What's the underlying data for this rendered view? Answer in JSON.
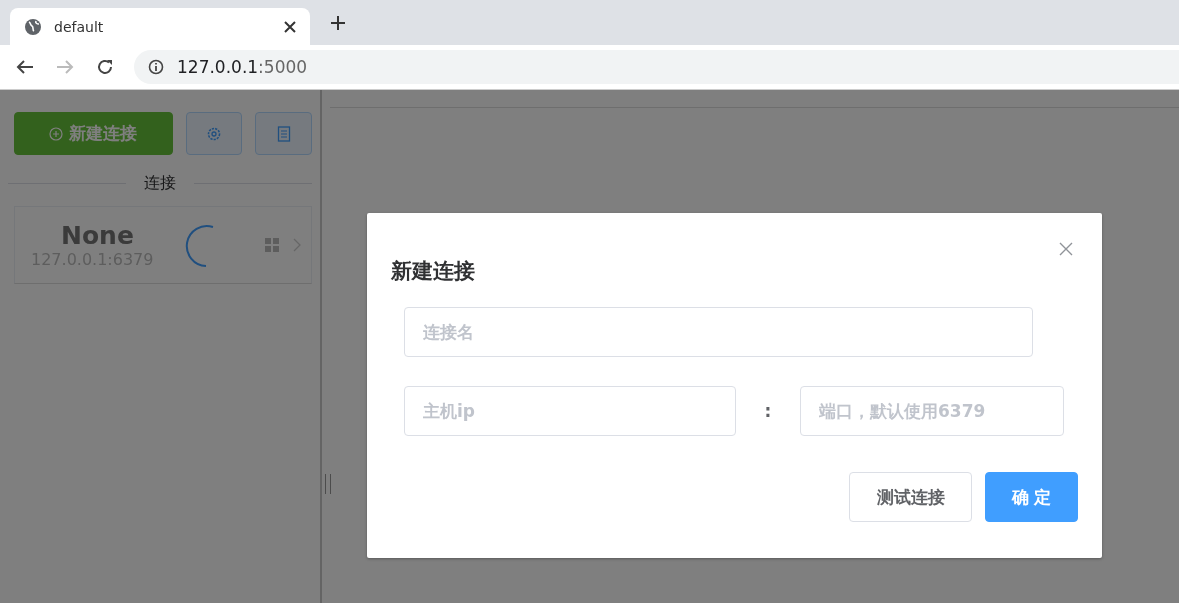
{
  "browser": {
    "tab": {
      "title": "default"
    },
    "address": {
      "host": "127.0.0.1",
      "port": ":5000"
    }
  },
  "sidebar": {
    "new_button": "新建连接",
    "section_title": "连接",
    "connections": [
      {
        "name": "None",
        "address": "127.0.0.1:6379",
        "loading": true
      }
    ]
  },
  "dialog": {
    "title": "新建连接",
    "fields": {
      "name": {
        "placeholder": "连接名"
      },
      "host": {
        "placeholder": "主机ip"
      },
      "separator": ":",
      "port": {
        "placeholder": "端口，默认使用6379"
      }
    },
    "buttons": [
      {
        "label": "测试连接",
        "kind": "default"
      },
      {
        "label": "确 定",
        "kind": "primary"
      }
    ]
  }
}
